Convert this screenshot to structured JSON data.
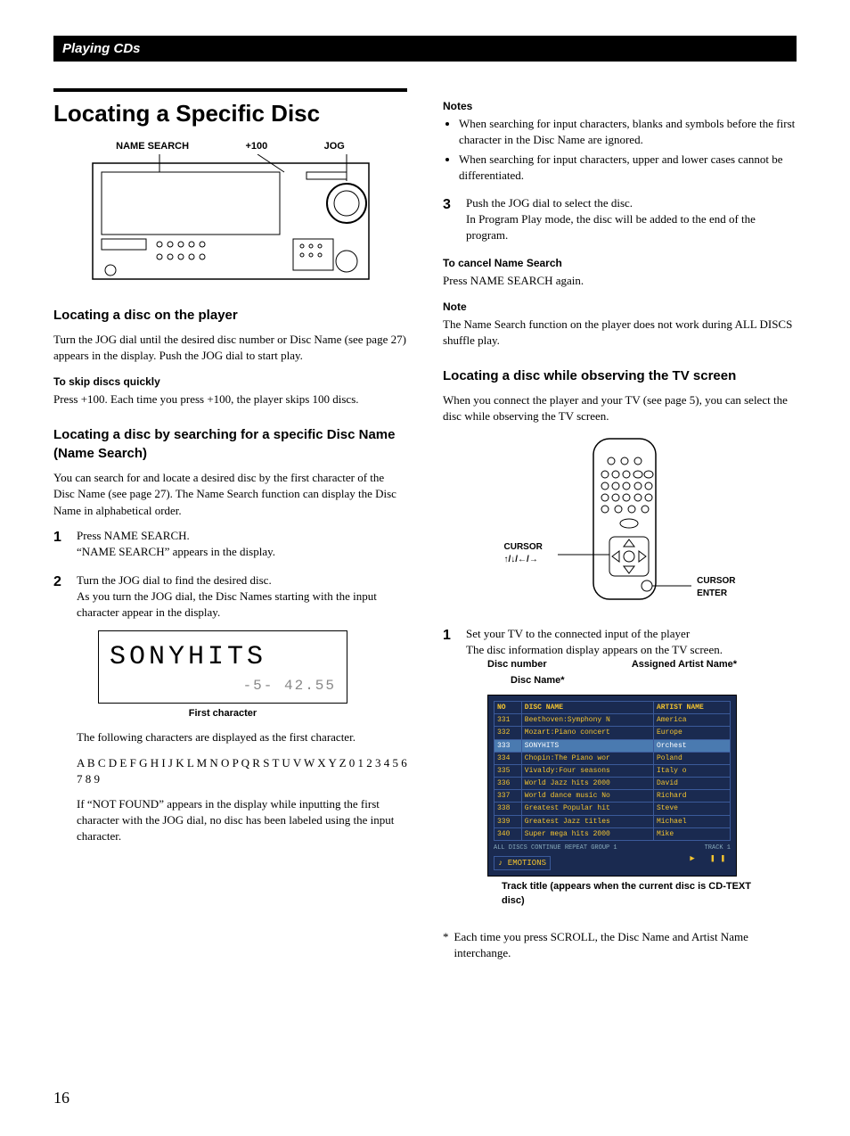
{
  "header": {
    "section_title": "Playing CDs"
  },
  "page_number": "16",
  "left": {
    "main_title": "Locating a Specific Disc",
    "device_labels": {
      "a": "NAME SEARCH",
      "b": "+100",
      "c": "JOG"
    },
    "h_locate_player": "Locating a disc on the player",
    "p_locate_player": "Turn the JOG dial until the desired disc number or Disc Name (see page 27) appears in the display. Push the JOG dial to start play.",
    "h_skip": "To skip discs quickly",
    "p_skip": "Press +100. Each time you press +100, the player skips 100 discs.",
    "h_name_search": "Locating a disc by searching for a specific Disc Name (Name Search)",
    "p_name_search": "You can search for and locate a desired disc by the first character of the Disc Name (see page 27). The Name Search function can display the Disc Name in alphabetical order.",
    "step1_a": "Press NAME SEARCH.",
    "step1_b": "“NAME SEARCH” appears in the display.",
    "step2_a": "Turn the JOG dial to find the desired disc.",
    "step2_b": "As you turn the JOG dial, the Disc Names starting with the input character appear in the display.",
    "lcd_main": "SONYHITS",
    "lcd_sub": "-5-   42.55",
    "lcd_caption": "First character",
    "p_following": "The following characters are displayed as the first character.",
    "p_chars": "A B C D E F G H I J K L M N O P Q R S T U V W X Y Z 0 1 2 3 4 5 6 7 8 9",
    "p_notfound": "If “NOT FOUND” appears in the display while inputting the first character with the JOG dial, no disc has been labeled using the input character."
  },
  "right": {
    "h_notes": "Notes",
    "note1": "When searching for input characters, blanks and symbols before the first character in the Disc Name are ignored.",
    "note2": "When searching for input characters, upper and lower cases cannot be differentiated.",
    "step3_a": "Push the JOG dial to select the disc.",
    "step3_b": "In Program Play mode, the disc will be added to the end of the program.",
    "h_cancel": "To cancel Name Search",
    "p_cancel": "Press NAME SEARCH again.",
    "h_note2": "Note",
    "p_note2": "The Name Search function on the player does not work during ALL DISCS shuffle play.",
    "h_tv": "Locating a disc while observing the TV screen",
    "p_tv": "When you connect the player and your TV (see page 5), you can select the disc while observing the TV screen.",
    "remote_label_a": "CURSOR",
    "remote_label_a2": "↑/↓/←/→",
    "remote_label_b": "CURSOR",
    "remote_label_b2": "ENTER",
    "tv_step1_a": "Set your TV to the connected input of the player",
    "tv_step1_b": "The disc information display appears on the TV screen.",
    "tv_label_discnum": "Disc number",
    "tv_label_artist": "Assigned Artist Name*",
    "tv_label_discname": "Disc Name*",
    "tv_headers": {
      "no": "NO",
      "disc": "DISC NAME",
      "artist": "ARTIST NAME"
    },
    "tv_rows": [
      {
        "no": "331",
        "disc": "Beethoven:Symphony N",
        "artist": "America"
      },
      {
        "no": "332",
        "disc": "Mozart:Piano concert",
        "artist": "Europe"
      },
      {
        "no": "333",
        "disc": "SONYHITS",
        "artist": "Orchest",
        "selected": true
      },
      {
        "no": "334",
        "disc": "Chopin:The Piano wor",
        "artist": "Poland"
      },
      {
        "no": "335",
        "disc": "Vivaldy:Four seasons",
        "artist": "Italy o"
      },
      {
        "no": "336",
        "disc": "World Jazz hits 2000",
        "artist": "David"
      },
      {
        "no": "337",
        "disc": "World dance music No",
        "artist": "Richard"
      },
      {
        "no": "338",
        "disc": "Greatest Popular hit",
        "artist": "Steve"
      },
      {
        "no": "339",
        "disc": "Greatest Jazz titles",
        "artist": "Michael"
      },
      {
        "no": "340",
        "disc": "Super mega hits 2000",
        "artist": "Mike"
      }
    ],
    "tv_footer_left": "ALL DISCS  CONTINUE   REPEAT   GROUP 1",
    "tv_footer_right": "TRACK 1",
    "tv_track_box": "♪ EMOTIONS",
    "tv_play_icons": "▶   ❚❚",
    "tv_caption": "Track title (appears when the current disc is CD-TEXT disc)",
    "p_footnote": "Each time you press SCROLL, the Disc Name and Artist Name interchange."
  },
  "nums": {
    "n1": "1",
    "n2": "2",
    "n3": "3",
    "star": "*"
  }
}
